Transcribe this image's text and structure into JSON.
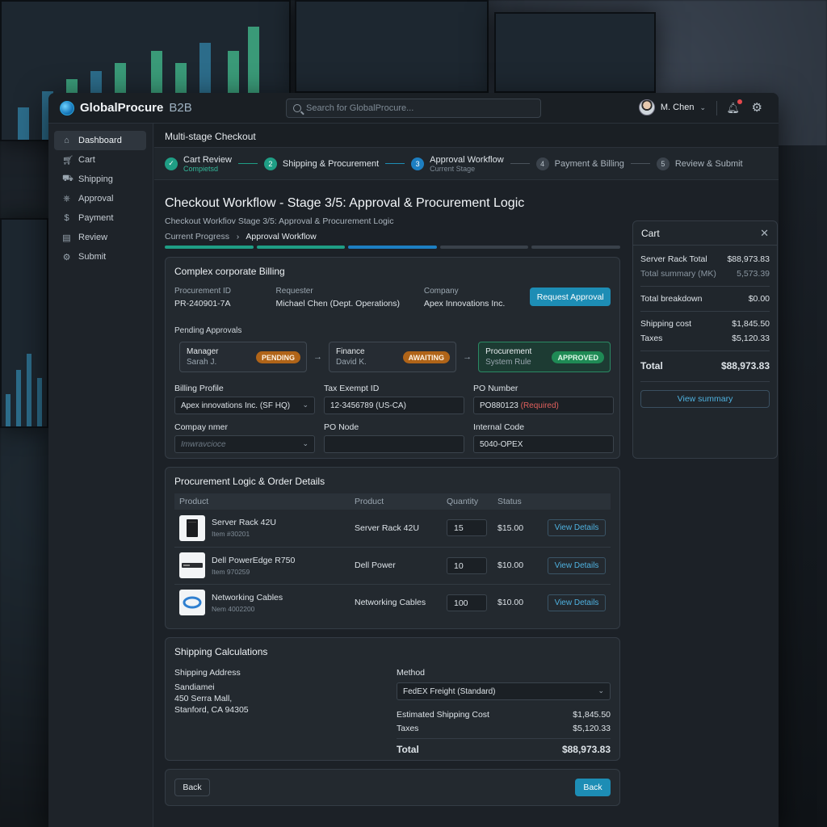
{
  "app": {
    "brand_bold": "GlobalProcure",
    "brand_light": "B2B",
    "search_placeholder": "Search for GlobalProcure...",
    "user_name": "M. Chen"
  },
  "sidebar": {
    "items": [
      {
        "label": "Dashboard",
        "icon": "home-icon"
      },
      {
        "label": "Cart",
        "icon": "cart-icon"
      },
      {
        "label": "Shipping",
        "icon": "truck-icon"
      },
      {
        "label": "Approval",
        "icon": "approval-icon"
      },
      {
        "label": "Payment",
        "icon": "payment-icon"
      },
      {
        "label": "Review",
        "icon": "review-icon"
      },
      {
        "label": "Submit",
        "icon": "submit-icon"
      }
    ]
  },
  "header": {
    "breadcrumb": "Multi-stage Checkout"
  },
  "stepper": [
    {
      "num": "✓",
      "label": "Cart Review",
      "sub": "Compietsd"
    },
    {
      "num": "2",
      "label": "Shipping & Procurement",
      "sub": ""
    },
    {
      "num": "3",
      "label": "Approval Workflow",
      "sub": "Current Stage"
    },
    {
      "num": "4",
      "label": "Payment & Billing",
      "sub": ""
    },
    {
      "num": "5",
      "label": "Review & Submit",
      "sub": ""
    }
  ],
  "page": {
    "title": "Checkout Workflow - Stage 3/5: Approval & Procurement Logic",
    "subtitle": "Checkout Workfiov Stage 3/5: Approval & Procurement Logic",
    "progress_label": "Current Progress",
    "progress_current": "Approval Workflow",
    "progress_fraction": 0.6
  },
  "billing": {
    "title": "Complex corporate Billing",
    "procurement_id_label": "Procurement ID",
    "procurement_id": "PR-240901-7A",
    "requester_label": "Requester",
    "requester": "Michael Chen (Dept. Operations)",
    "company_label": "Company",
    "company": "Apex Innovations Inc.",
    "request_button": "Request Approval",
    "pending_label": "Pending Approvals",
    "approvals": [
      {
        "name": "Manager",
        "who": "Sarah J.",
        "status": "PENDING"
      },
      {
        "name": "Finance",
        "who": "David K.",
        "status": "AWAITING"
      },
      {
        "name": "Procurement",
        "who": "System Rule",
        "status": "APPROVED"
      }
    ],
    "fields": {
      "billing_profile_label": "Billing Profile",
      "billing_profile": "Apex innovations Inc. (SF HQ)",
      "tax_label": "Tax Exempt ID",
      "tax": "12-3456789 (US-CA)",
      "po_label": "PO Number",
      "po": "PO880123",
      "po_req": "(Required)",
      "company_name_label": "Compay nmer",
      "company_name_placeholder": "Imwravcioce",
      "po_node_label": "PO Node",
      "po_node": "",
      "internal_label": "Internal Code",
      "internal": "5040-OPEX"
    }
  },
  "order": {
    "title": "Procurement Logic & Order Details",
    "columns": [
      "Product",
      "Product",
      "Quantity",
      "Status"
    ],
    "rows": [
      {
        "name": "Server Rack 42U",
        "item": "Item #30201",
        "product": "Server Rack 42U",
        "qty": "15",
        "price": "$15.00",
        "action": "View Details"
      },
      {
        "name": "Dell PowerEdge R750",
        "item": "Item 970259",
        "product": "Dell Power",
        "qty": "10",
        "price": "$10.00",
        "action": "View Details"
      },
      {
        "name": "Networking Cables",
        "item": "Nem 4002200",
        "product": "Networking Cables",
        "qty": "100",
        "price": "$10.00",
        "action": "View Details"
      }
    ]
  },
  "shipping": {
    "title": "Shipping Calculations",
    "address_label": "Shipping Address",
    "address_lines": [
      "Sandiamei",
      "450 Serra Mall,",
      "Stanford, CA 94305"
    ],
    "method_label": "Method",
    "method": "FedEX Freight (Standard)",
    "est_label": "Estimated Shipping Cost",
    "est": "$1,845.50",
    "taxes_label": "Taxes",
    "taxes": "$5,120.33",
    "total_label": "Total",
    "total": "$88,973.83"
  },
  "footer": {
    "back_left": "Back",
    "back_right": "Back"
  },
  "cart": {
    "title": "Cart",
    "rows": [
      {
        "label": "Server Rack Total",
        "value": "$88,973.83"
      },
      {
        "label": "Total summary (MK)",
        "value": "5,573.39"
      },
      {
        "label": "Total breakdown",
        "value": "$0.00"
      },
      {
        "label": "Shipping cost",
        "value": "$1,845.50"
      },
      {
        "label": "Taxes",
        "value": "$5,120.33"
      }
    ],
    "total_label": "Total",
    "total": "$88,973.83",
    "button": "View summary"
  },
  "colors": {
    "accent": "#1d8db5",
    "success": "#1f9e85",
    "pending": "#b06418"
  }
}
